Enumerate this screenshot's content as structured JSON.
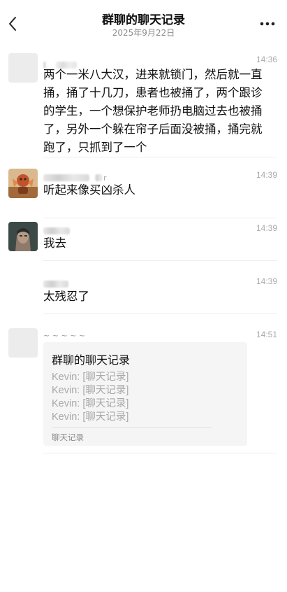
{
  "header": {
    "title": "群聊的聊天记录",
    "date": "2025年9月22日",
    "back_icon": "chevron-left-icon",
    "more_icon": "ellipsis-icon"
  },
  "messages": [
    {
      "time": "14:36",
      "text": "两个一米八大汉，进来就锁门，然后就一直捅，捅了十几刀，患者也被捅了，两个跟诊的学生，一个想保护老师扔电脑过去也被捅了，另外一个躲在帘子后面没被捅，捅完就跑了，只抓到了一个"
    },
    {
      "time": "14:39",
      "name_suffix": "r",
      "text": "听起来像买凶杀人"
    },
    {
      "time": "14:39",
      "text": "我去"
    },
    {
      "time": "14:39",
      "text": "太残忍了"
    },
    {
      "time": "14:51",
      "name": "~ ~ ~ ~ ~",
      "card": {
        "title": "群聊的聊天记录",
        "lines": [
          "Kevin: [聊天记录]",
          "Kevin: [聊天记录]",
          "Kevin: [聊天记录]",
          "Kevin: [聊天记录]"
        ],
        "footer": "聊天记录"
      }
    }
  ]
}
